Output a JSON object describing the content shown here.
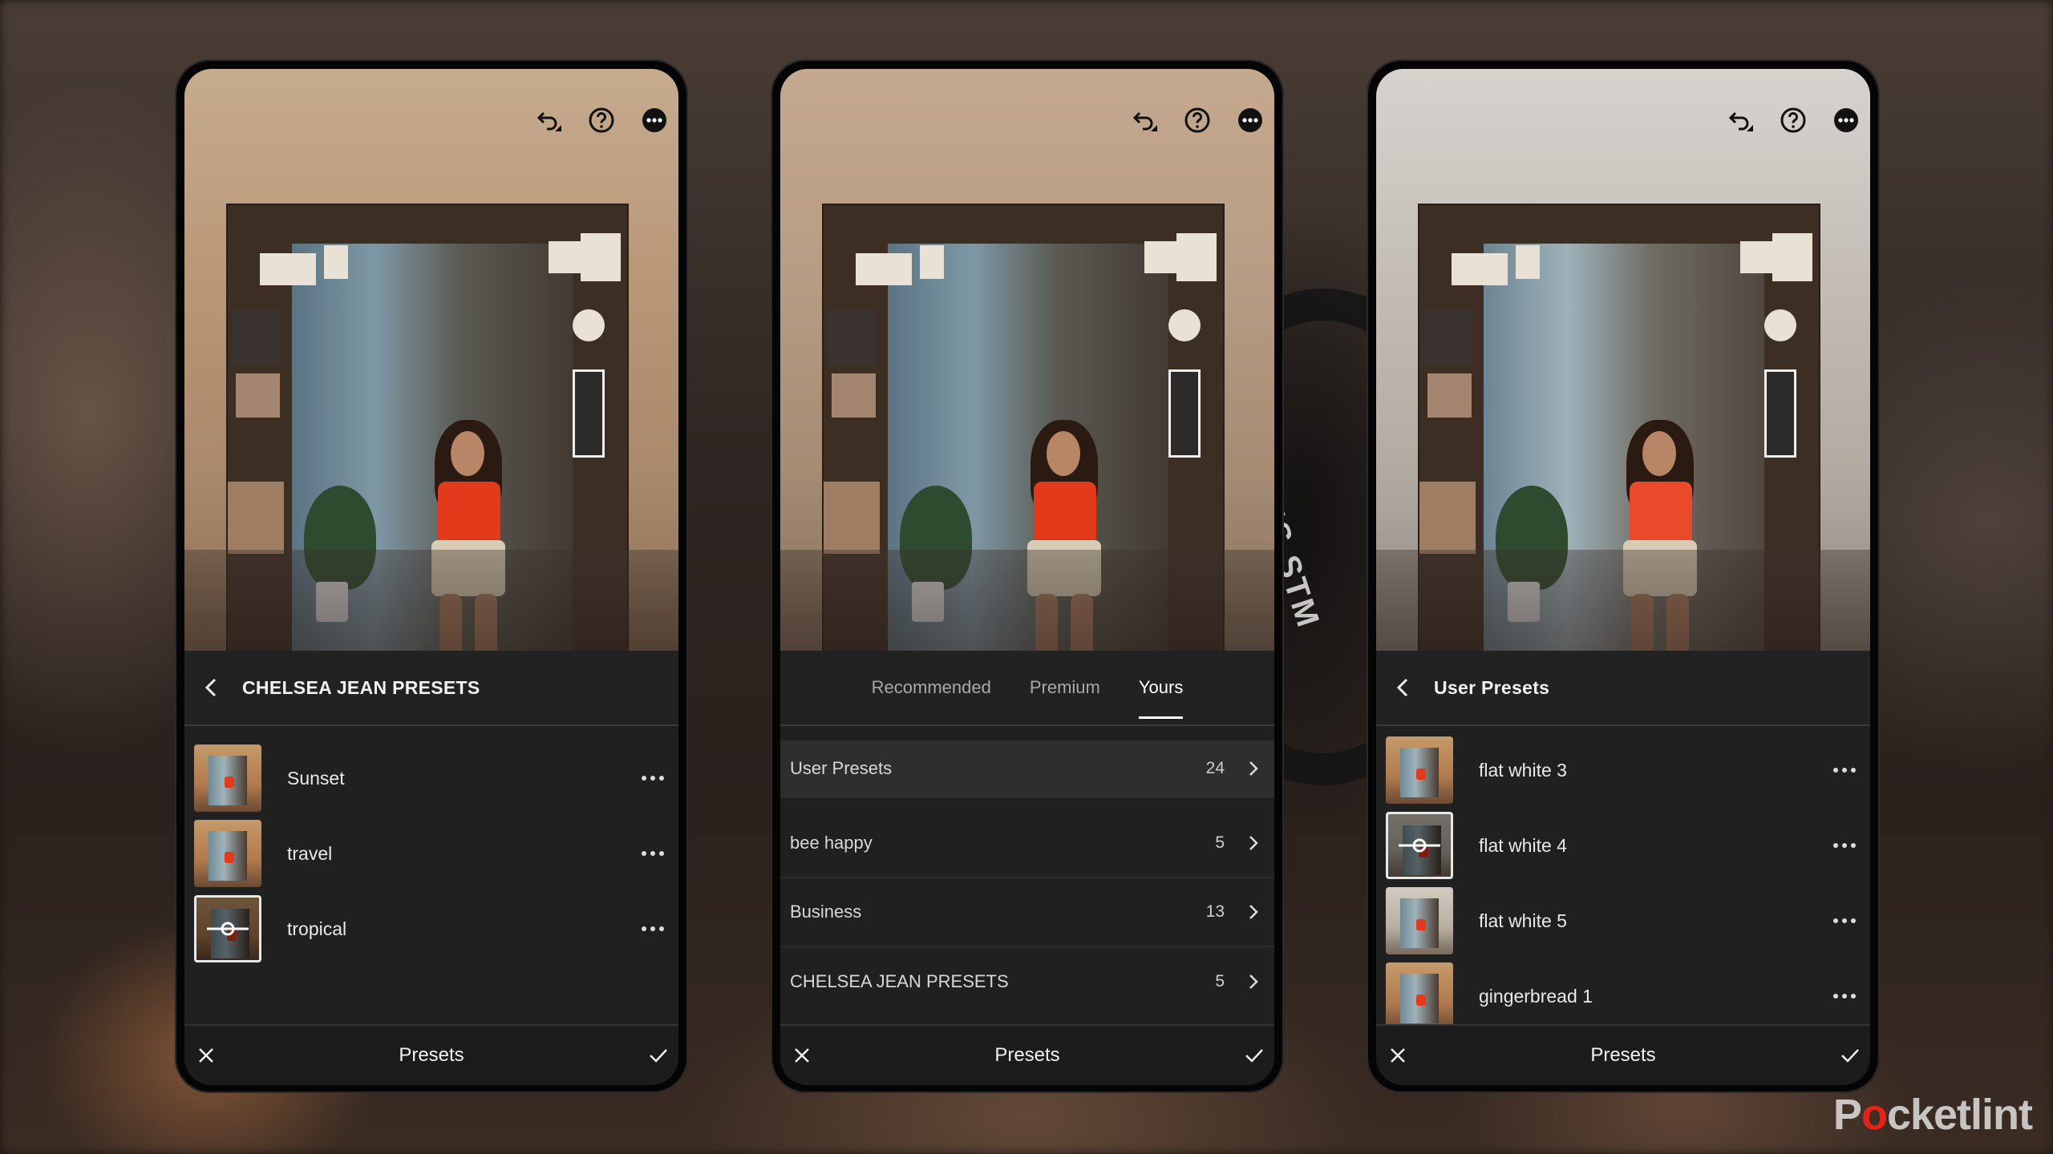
{
  "background": {
    "lens_text": "6 IS STM"
  },
  "watermark": {
    "text_before": "P",
    "o": "o",
    "text_after": "cketlint"
  },
  "top_icons": [
    "undo-icon",
    "help-icon",
    "more-icon"
  ],
  "phone1": {
    "header_title": "CHELSEA JEAN PRESETS",
    "items": [
      {
        "name": "Sunset"
      },
      {
        "name": "travel"
      },
      {
        "name": "tropical"
      }
    ],
    "bottom_title": "Presets"
  },
  "phone2": {
    "tabs": [
      {
        "label": "Recommended"
      },
      {
        "label": "Premium"
      },
      {
        "label": "Yours"
      }
    ],
    "active_tab": "Yours",
    "groups": [
      {
        "name": "User Presets",
        "count": "24"
      },
      {
        "name": "bee happy",
        "count": "5"
      },
      {
        "name": "Business",
        "count": "13"
      },
      {
        "name": "CHELSEA JEAN PRESETS",
        "count": "5"
      }
    ],
    "bottom_title": "Presets"
  },
  "phone3": {
    "header_title": "User Presets",
    "items": [
      {
        "name": "flat white 3"
      },
      {
        "name": "flat white 4"
      },
      {
        "name": "flat white 5"
      },
      {
        "name": "gingerbread 1"
      }
    ],
    "bottom_title": "Presets"
  },
  "colors": {
    "panel": "#222222",
    "bar": "#1c1c1c",
    "text": "#f1f1f1",
    "accent_red": "#e2231a"
  }
}
